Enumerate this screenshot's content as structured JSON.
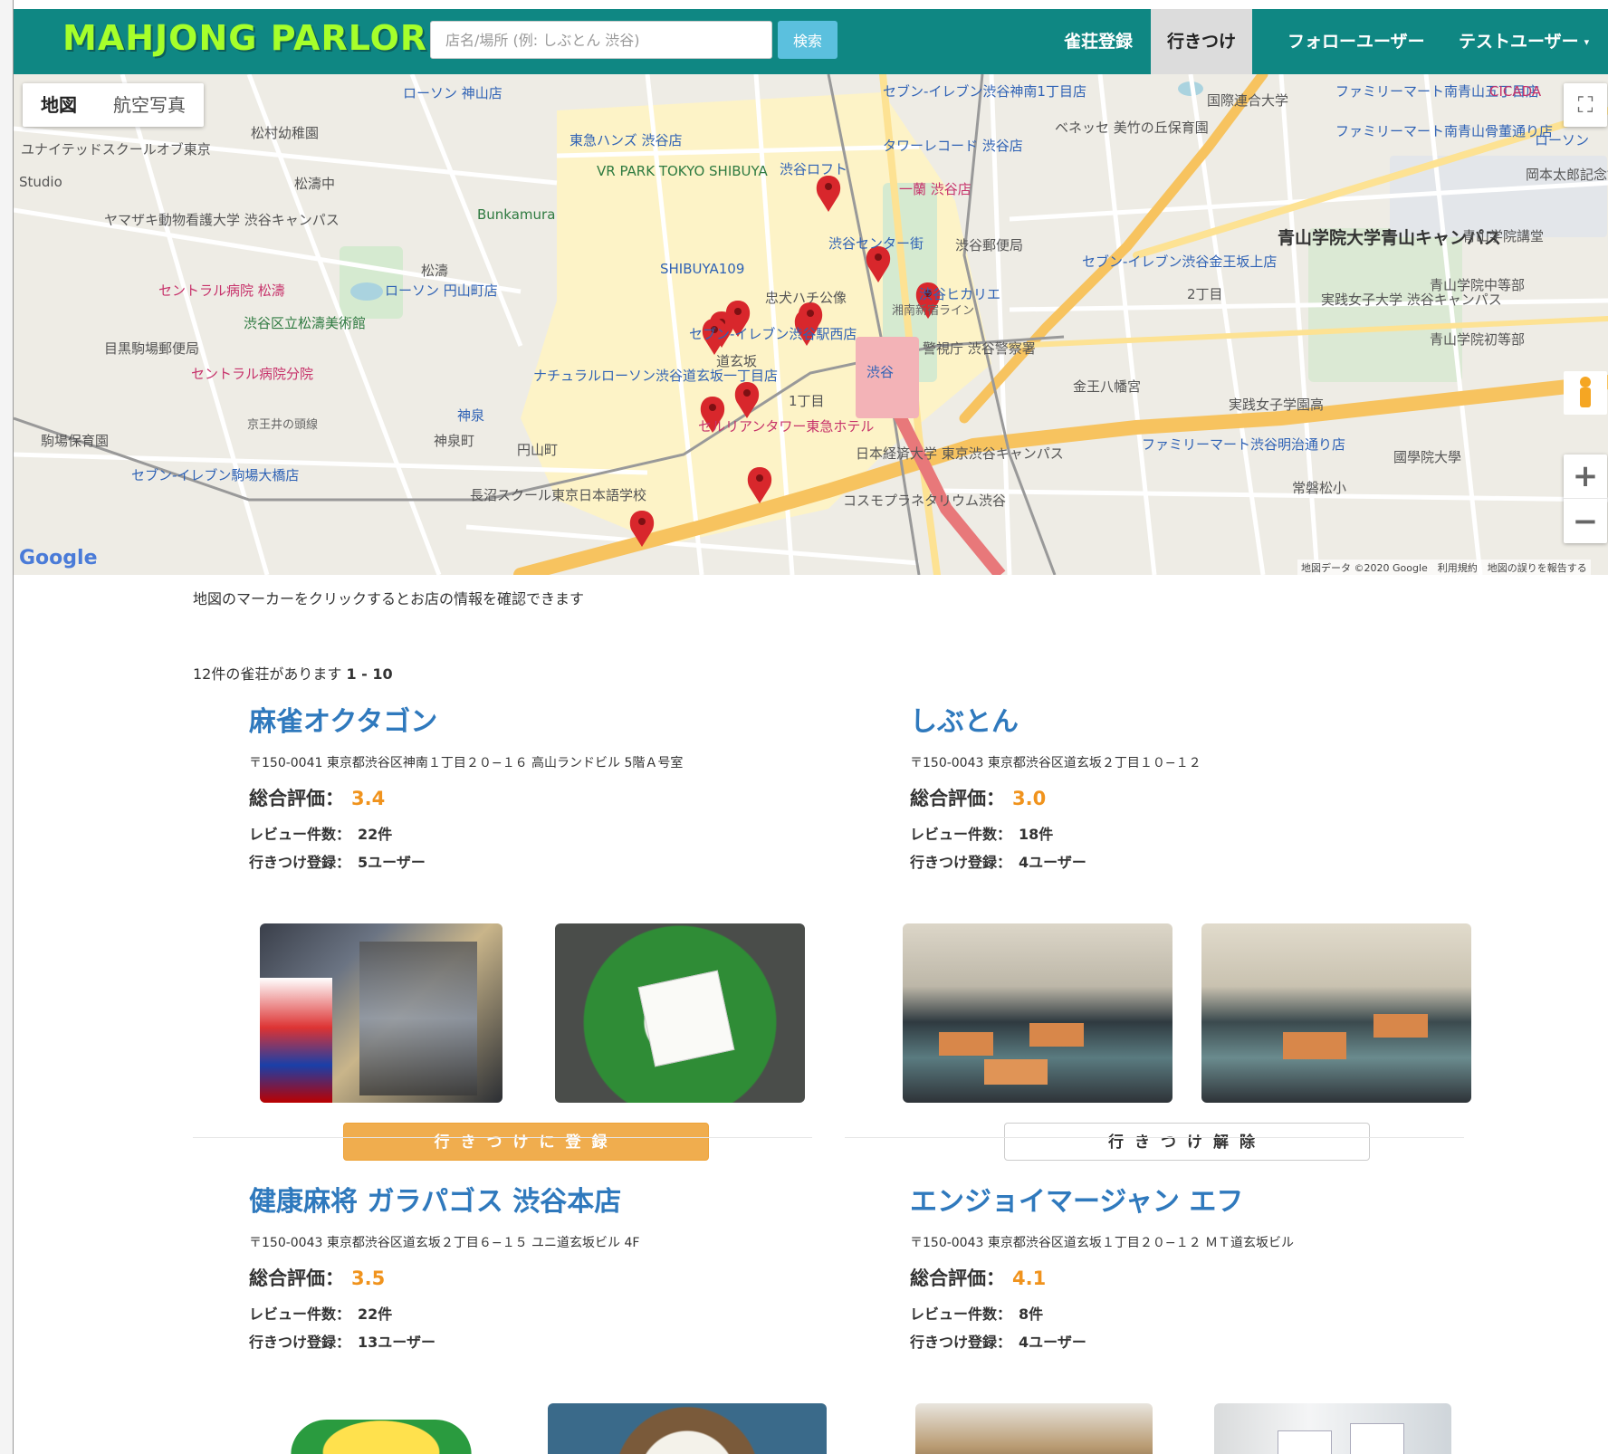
{
  "app": {
    "logo": "MAHJONG PARLOR"
  },
  "navbar": {
    "search_placeholder": "店名/場所 (例: しぶとん 渋谷)",
    "search_button": "検索",
    "items": [
      {
        "label": "雀荘登録",
        "active": false
      },
      {
        "label": "行きつけ",
        "active": true
      },
      {
        "label": "フォローユーザー",
        "active": false
      },
      {
        "label": "テストユーザー",
        "active": false,
        "dropdown": true
      }
    ]
  },
  "map": {
    "type_buttons": [
      "地図",
      "航空写真"
    ],
    "google_logo": "Google",
    "footer": "地図データ ©2020 Google　利用規約　地図の誤りを報告する",
    "marker_count": 12,
    "labels": [
      "ローソン 神山店",
      "セブン-イレブン渋谷神南1丁目店",
      "国際連合大学",
      "ファミリーマート南青山五丁目店",
      "CICADA",
      "松村幼稚園",
      "東急ハンズ 渋谷店",
      "タワーレコード 渋谷店",
      "ベネッセ 美竹の丘保育園",
      "ファミリーマート南青山骨董通り店",
      "ローソン",
      "ユナイテッドスクールオブ東京",
      "VR PARK TOKYO SHIBUYA",
      "渋谷ロフト",
      "一蘭 渋谷店",
      "岡本太郎記念館",
      "Studio",
      "松濤中",
      "Bunkamura",
      "渋谷センター街",
      "渋谷郵便局",
      "青山学院大学青山キャンパス",
      "青山学院講堂",
      "ヤマザキ動物看護大学 渋谷キャンパス",
      "SHIBUYA109",
      "セブン-イレブン渋谷金王坂上店",
      "松濤",
      "ローソン 円山町店",
      "忠犬ハチ公像",
      "渋谷ヒカリエ",
      "セントラル病院 松濤",
      "渋谷区立松濤美術館",
      "実践女子大学 渋谷キャンパス",
      "青山学院中等部",
      "セブン-イレブン渋谷駅西店",
      "警視庁 渋谷警察署",
      "目黒駒場郵便局",
      "セントラル病院分院",
      "ナチュラルローソン渋谷道玄坂一丁目店",
      "渋谷",
      "金王八幡宮",
      "青山学院初等部",
      "京王井の頭線",
      "神泉",
      "セルリアンタワー東急ホテル",
      "実践女子学園高",
      "駒場保育園",
      "神泉町",
      "円山町",
      "日本経済大学 東京渋谷キャンパス",
      "ファミリーマート渋谷明治通り店",
      "國學院大學",
      "セブン-イレブン駒場大橋店",
      "長沼スクール東京日本語学校",
      "コスモプラネタリウム渋谷",
      "常磐松小",
      "湘南新宿ライン",
      "道玄坂",
      "1丁目",
      "2丁目"
    ]
  },
  "content": {
    "hint": "地図のマーカーをクリックするとお店の情報を確認できます",
    "count_prefix": "12件の雀荘があります",
    "count_range": "1 - 10",
    "labels": {
      "rating": "総合評価：",
      "reviews": "レビュー件数：",
      "regulars": "行きつけ登録："
    },
    "shops": [
      {
        "name": "麻雀オクタゴン",
        "address": "〒150-0041 東京都渋谷区神南１丁目２０−１６ 高山ランドビル 5階Ａ号室",
        "rating": "3.4",
        "reviews": "22件",
        "regulars": "5ユーザー",
        "button": "行きつけに登録",
        "registered": false
      },
      {
        "name": "しぶとん",
        "address": "〒150-0043 東京都渋谷区道玄坂２丁目１０−１２",
        "rating": "3.0",
        "reviews": "18件",
        "regulars": "4ユーザー",
        "button": "行きつけ解除",
        "registered": true
      },
      {
        "name": "健康麻将 ガラパゴス 渋谷本店",
        "address": "〒150-0043 東京都渋谷区道玄坂２丁目６−１５ ユニ道玄坂ビル 4F",
        "rating": "3.5",
        "reviews": "22件",
        "regulars": "13ユーザー",
        "button": "",
        "registered": false
      },
      {
        "name": "エンジョイマージャン エフ",
        "address": "〒150-0043 東京都渋谷区道玄坂１丁目２０−１２ ＭＴ道玄坂ビル",
        "rating": "4.1",
        "reviews": "8件",
        "regulars": "4ユーザー",
        "button": "",
        "registered": false
      }
    ]
  },
  "colors": {
    "navbar": "#0f8783",
    "logo": "#a6ff2b",
    "shop_name": "#2f79bd",
    "rating": "#f0931d",
    "register_button": "#f0ad4e"
  }
}
